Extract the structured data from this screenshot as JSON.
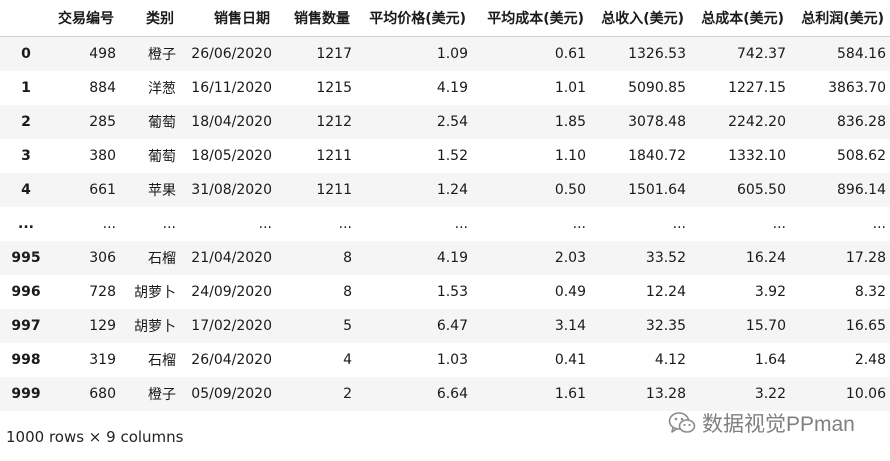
{
  "table": {
    "columns": [
      "",
      "交易编号",
      "类别",
      "销售日期",
      "销售数量",
      "平均价格(美元)",
      "平均成本(美元)",
      "总收入(美元)",
      "总成本(美元)",
      "总利润(美元)"
    ],
    "rows": [
      [
        "0",
        "498",
        "橙子",
        "26/06/2020",
        "1217",
        "1.09",
        "0.61",
        "1326.53",
        "742.37",
        "584.16"
      ],
      [
        "1",
        "884",
        "洋葱",
        "16/11/2020",
        "1215",
        "4.19",
        "1.01",
        "5090.85",
        "1227.15",
        "3863.70"
      ],
      [
        "2",
        "285",
        "葡萄",
        "18/04/2020",
        "1212",
        "2.54",
        "1.85",
        "3078.48",
        "2242.20",
        "836.28"
      ],
      [
        "3",
        "380",
        "葡萄",
        "18/05/2020",
        "1211",
        "1.52",
        "1.10",
        "1840.72",
        "1332.10",
        "508.62"
      ],
      [
        "4",
        "661",
        "苹果",
        "31/08/2020",
        "1211",
        "1.24",
        "0.50",
        "1501.64",
        "605.50",
        "896.14"
      ],
      [
        "...",
        "...",
        "...",
        "...",
        "...",
        "...",
        "...",
        "...",
        "...",
        "..."
      ],
      [
        "995",
        "306",
        "石榴",
        "21/04/2020",
        "8",
        "4.19",
        "2.03",
        "33.52",
        "16.24",
        "17.28"
      ],
      [
        "996",
        "728",
        "胡萝卜",
        "24/09/2020",
        "8",
        "1.53",
        "0.49",
        "12.24",
        "3.92",
        "8.32"
      ],
      [
        "997",
        "129",
        "胡萝卜",
        "17/02/2020",
        "5",
        "6.47",
        "3.14",
        "32.35",
        "15.70",
        "16.65"
      ],
      [
        "998",
        "319",
        "石榴",
        "26/04/2020",
        "4",
        "1.03",
        "0.41",
        "4.12",
        "1.64",
        "2.48"
      ],
      [
        "999",
        "680",
        "橙子",
        "05/09/2020",
        "2",
        "6.64",
        "1.61",
        "13.28",
        "3.22",
        "10.06"
      ]
    ]
  },
  "footer": {
    "shape_text": "1000 rows × 9 columns"
  },
  "watermark": {
    "text": "数据视觉PPman",
    "icon": "wechat-icon"
  }
}
